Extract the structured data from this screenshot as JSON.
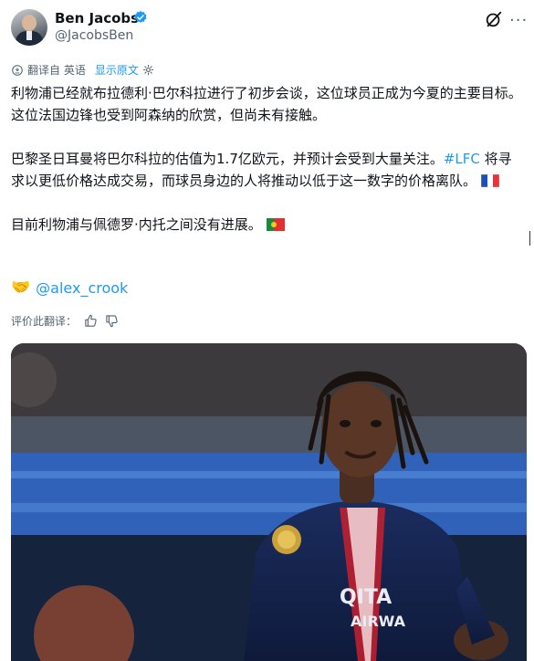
{
  "author": {
    "name": "Ben Jacobs",
    "handle": "@JacobsBen"
  },
  "translation": {
    "label": "翻译自 英语",
    "show_original": "显示原文"
  },
  "tweet": {
    "line1": "利物浦已经就布拉德利·巴尔科拉进行了初步会谈，这位球员正成为今夏的主要目标。这位法国边锋也受到阿森纳的欣赏，但尚未有接触。",
    "line2a": "巴黎圣日耳曼将巴尔科拉的估值为1.7亿欧元，并预计会受到大量关注。",
    "hashtag": "#LFC",
    "line2b": " 将寻求以更低价格达成交易，而球员身边的人将推动以低于这一数字的价格离队。",
    "line3": "目前利物浦与佩德罗·内托之间没有进展。",
    "mention": "@alex_crook"
  },
  "rating": {
    "label": "评价此翻译："
  },
  "icons": {
    "verified": "verified-badge-icon",
    "grok": "grok-icon",
    "more": "more-options-icon",
    "translate": "translate-icon",
    "settings": "gear-icon",
    "handshake": "handshake-emoji-icon",
    "thumbs_up": "thumbs-up-icon",
    "thumbs_down": "thumbs-down-icon",
    "flag_fr": "france-flag-icon",
    "flag_pt": "portugal-flag-icon"
  },
  "colors": {
    "accent": "#1d9bf0",
    "secondary_text": "#536471",
    "primary_text": "#0f1419"
  }
}
